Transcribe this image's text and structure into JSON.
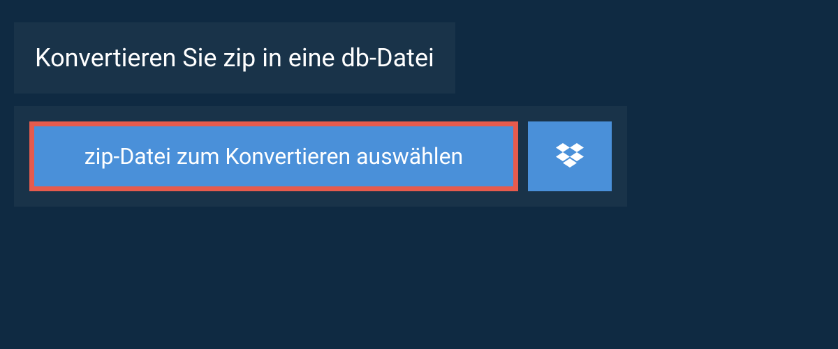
{
  "header": {
    "title": "Konvertieren Sie zip in eine db-Datei"
  },
  "upload": {
    "select_file_label": "zip-Datei zum Konvertieren auswählen",
    "dropbox_icon_name": "dropbox-icon"
  },
  "colors": {
    "background": "#0f2a42",
    "panel": "#193349",
    "button_primary": "#4a90d9",
    "highlight_border": "#e65b4d",
    "text": "#ffffff"
  }
}
